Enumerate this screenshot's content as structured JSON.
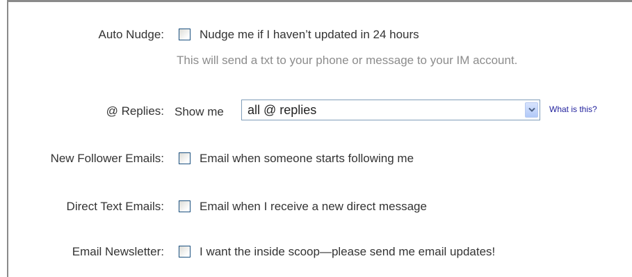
{
  "settings": {
    "auto_nudge": {
      "label": "Auto Nudge:",
      "checkbox_text": "Nudge me if I haven’t updated in 24 hours",
      "checked": false,
      "note": "This will send a txt to your phone or message to your IM account."
    },
    "replies": {
      "label": "@ Replies:",
      "prefix": "Show me",
      "selected": "all @ replies",
      "help_link": "What is this?"
    },
    "new_follower_emails": {
      "label": "New Follower Emails:",
      "checkbox_text": "Email when someone starts following me",
      "checked": false
    },
    "direct_text_emails": {
      "label": "Direct Text Emails:",
      "checkbox_text": "Email when I receive a new direct message",
      "checked": false
    },
    "email_newsletter": {
      "label": "Email Newsletter:",
      "checkbox_text": "I want the inside scoop—please send me email updates!",
      "checked": false
    }
  },
  "colors": {
    "label_text": "#333333",
    "note_text": "#8c8c8c",
    "link": "#1f1f9c",
    "frame": "#8a8a8a"
  }
}
